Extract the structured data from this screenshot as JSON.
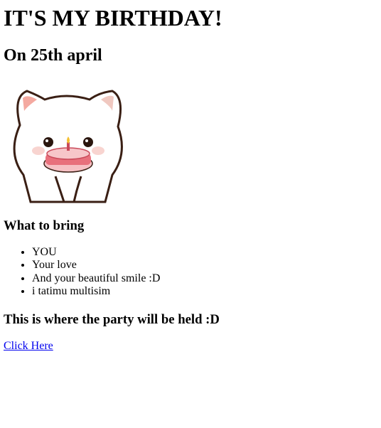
{
  "page": {
    "title": "IT'S MY BIRTHDAY!",
    "date_heading": "On 25th april",
    "image_alt": "cat-with-cake",
    "bring_heading": "What to bring",
    "bring_items": [
      "YOU",
      "Your love",
      "And your beautiful smile :D",
      "i tatimu multisim"
    ],
    "party_heading": "This is where the party will be held :D",
    "link_text": "Click Here"
  },
  "colors": {
    "link": "#0000ee",
    "cat_outline": "#3a1f14",
    "cat_ear": "#f4a9a0",
    "cake": "#e8707c"
  }
}
